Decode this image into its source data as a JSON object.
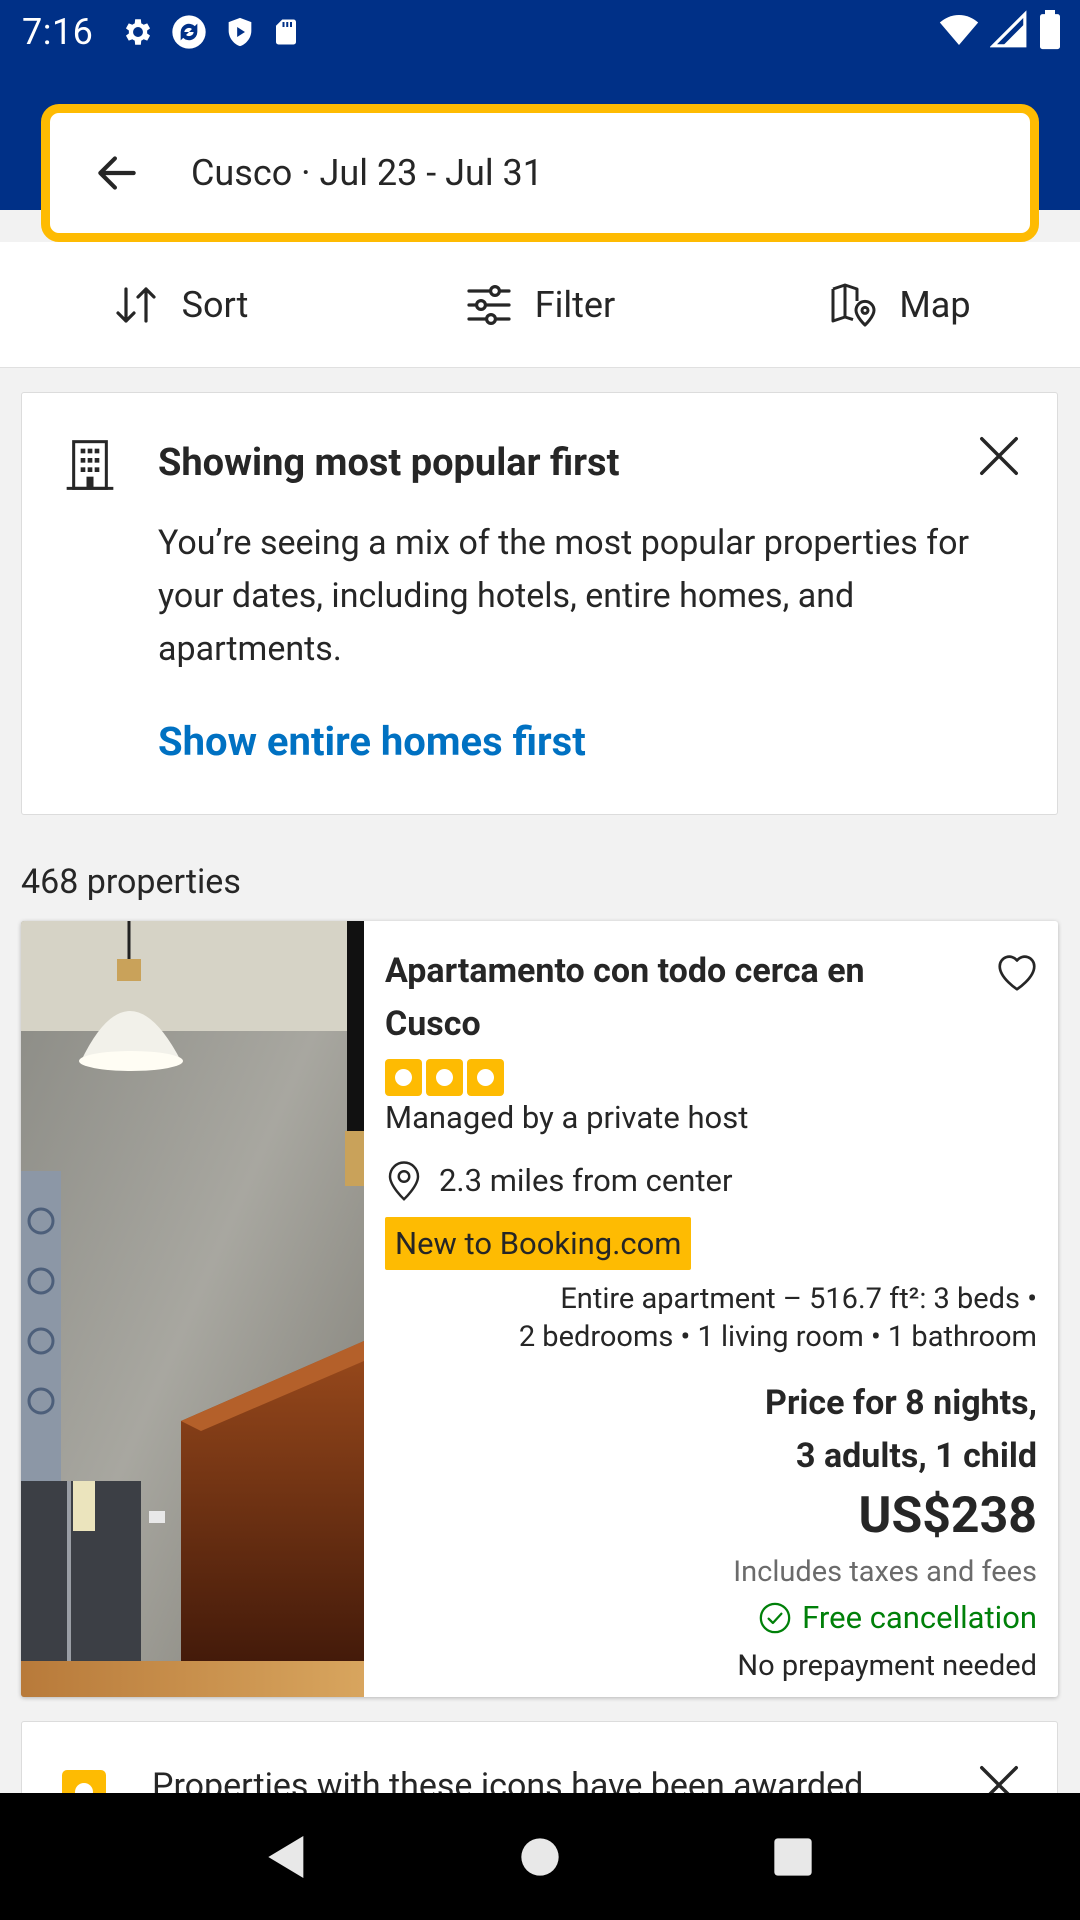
{
  "status_bar": {
    "time": "7:16",
    "left_icons": [
      "settings-icon",
      "sync-icon",
      "shield-play-icon",
      "sd-card-icon"
    ],
    "right_icons": [
      "wifi-icon",
      "signal-icon",
      "battery-icon"
    ]
  },
  "search": {
    "query": "Cusco · Jul 23 - Jul 31"
  },
  "toolbar": {
    "sort_label": "Sort",
    "filter_label": "Filter",
    "map_label": "Map"
  },
  "banner": {
    "title": "Showing most popular first",
    "description": "You’re seeing a mix of the most popular properties for your dates, including hotels, entire homes, and apartments.",
    "link": "Show entire homes first"
  },
  "results": {
    "count_label": "468 properties"
  },
  "property": {
    "name": "Apartamento con todo cerca en Cusco",
    "star_rating": 3,
    "host": "Managed by a private host",
    "distance": "2.3 miles from center",
    "badge": "New to Booking.com",
    "unit_line1": "Entire apartment – 516.7 ft²: 3 beds •",
    "unit_line2": "2 bedrooms • 1 living room • 1 bathroom",
    "price_for_line1": "Price for 8 nights,",
    "price_for_line2": "3 adults, 1 child",
    "price": "US$238",
    "taxes": "Includes taxes and fees",
    "free_cancellation": "Free cancellation",
    "no_prepayment": "No prepayment needed"
  },
  "next_card": {
    "text": "Properties with these icons have been awarded"
  },
  "colors": {
    "brand_blue": "#003087",
    "accent_yellow": "#febb02",
    "link_blue": "#0071c2",
    "success_green": "#008009"
  }
}
